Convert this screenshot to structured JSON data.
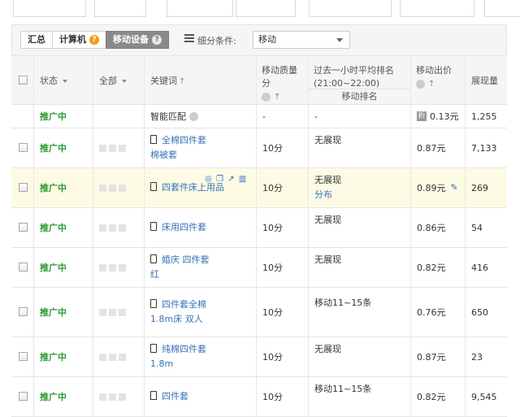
{
  "filter_bar": {
    "tabs": [
      {
        "label": "汇总",
        "active": false,
        "help": false
      },
      {
        "label": "计算机",
        "active": false,
        "help": true
      },
      {
        "label": "移动设备",
        "active": true,
        "help": true
      }
    ],
    "segment_label": "细分条件:",
    "segment_value": "移动"
  },
  "table": {
    "columns": {
      "status": "状态",
      "all": "全部",
      "keyword": "关键词",
      "quality": "移动质量分",
      "rank_title": "过去一小时平均排名(21:00~22:00)",
      "rank_sub": "移动排名",
      "bid": "移动出价",
      "impressions": "展现量"
    },
    "smart_row": {
      "status": "推广中",
      "keyword": "智能匹配",
      "quality": "-",
      "rank": "-",
      "discount_badge": "折",
      "bid": "0.13元",
      "impressions": "1,255"
    },
    "rows": [
      {
        "status": "推广中",
        "keyword": "全棉四件套 棉被套",
        "quality": "10分",
        "rank": "无展现",
        "rank_link": "",
        "bid": "0.87元",
        "impressions": "7,133"
      },
      {
        "status": "推广中",
        "keyword": "四套件床上用品",
        "quality": "10分",
        "rank": "无展现",
        "rank_link": "分布",
        "bid": "0.89元",
        "impressions": "269"
      },
      {
        "status": "推广中",
        "keyword": "床用四件套",
        "quality": "10分",
        "rank": "无展现",
        "rank_link": "",
        "bid": "0.86元",
        "impressions": "54"
      },
      {
        "status": "推广中",
        "keyword": "婚庆 四件套 红",
        "quality": "10分",
        "rank": "无展现",
        "rank_link": "",
        "bid": "0.82元",
        "impressions": "416"
      },
      {
        "status": "推广中",
        "keyword": "四件套全棉 1.8m床 双人",
        "quality": "10分",
        "rank": "移动11~15条",
        "rank_link": "",
        "bid": "0.76元",
        "impressions": "650"
      },
      {
        "status": "推广中",
        "keyword": "纯棉四件套1.8m",
        "quality": "10分",
        "rank": "无展现",
        "rank_link": "",
        "bid": "0.87元",
        "impressions": "23"
      },
      {
        "status": "推广中",
        "keyword": "四件套",
        "quality": "10分",
        "rank": "移动11~15条",
        "rank_link": "",
        "bid": "0.82元",
        "impressions": "9,545"
      }
    ]
  }
}
